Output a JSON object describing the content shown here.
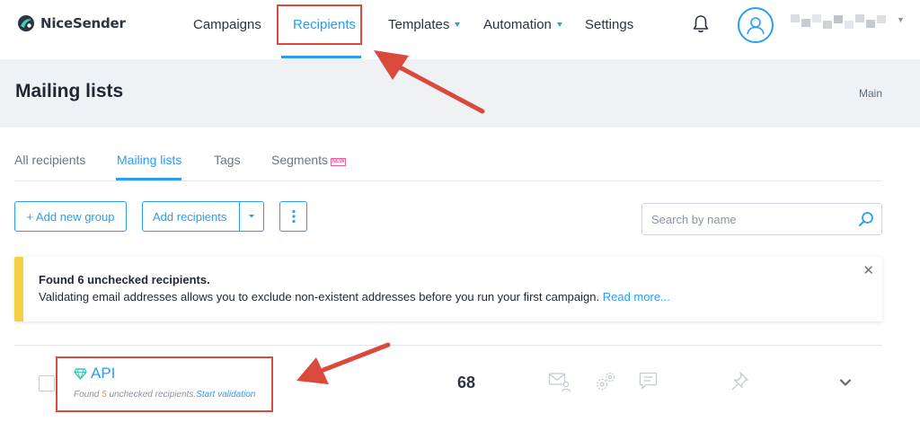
{
  "brand": {
    "name": "NiceSender"
  },
  "nav": {
    "campaigns": "Campaigns",
    "recipients": "Recipients",
    "templates": "Templates",
    "automation": "Automation",
    "settings": "Settings"
  },
  "header": {
    "title": "Mailing lists",
    "breadcrumb": "Main"
  },
  "tabs": {
    "all_recipients": "All recipients",
    "mailing_lists": "Mailing lists",
    "tags": "Tags",
    "segments": "Segments",
    "segments_badge": "NEW"
  },
  "toolbar": {
    "add_group": "+ Add new group",
    "add_recipients": "Add recipients",
    "search_placeholder": "Search by name"
  },
  "alert": {
    "title": "Found 6 unchecked recipients.",
    "body": "Validating email addresses allows you to exclude non-existent addresses before you run your first campaign.",
    "link": "Read more..."
  },
  "list": {
    "name": "API",
    "sub_prefix": "Found",
    "sub_count": "5",
    "sub_suffix": "unchecked recipients.",
    "sub_link": "Start validation",
    "total": "68"
  },
  "colors": {
    "accent": "#2a9df4",
    "annotation": "#d94a3d",
    "alert_bar": "#f6cf44",
    "header_band": "#eef2f5"
  },
  "icons": [
    "logo-mark-icon",
    "bell-icon",
    "user-icon",
    "search-icon",
    "diamond-icon",
    "mail-user-icon",
    "gears-icon",
    "comment-icon",
    "pin-icon",
    "chevron-down-icon",
    "close-icon"
  ]
}
